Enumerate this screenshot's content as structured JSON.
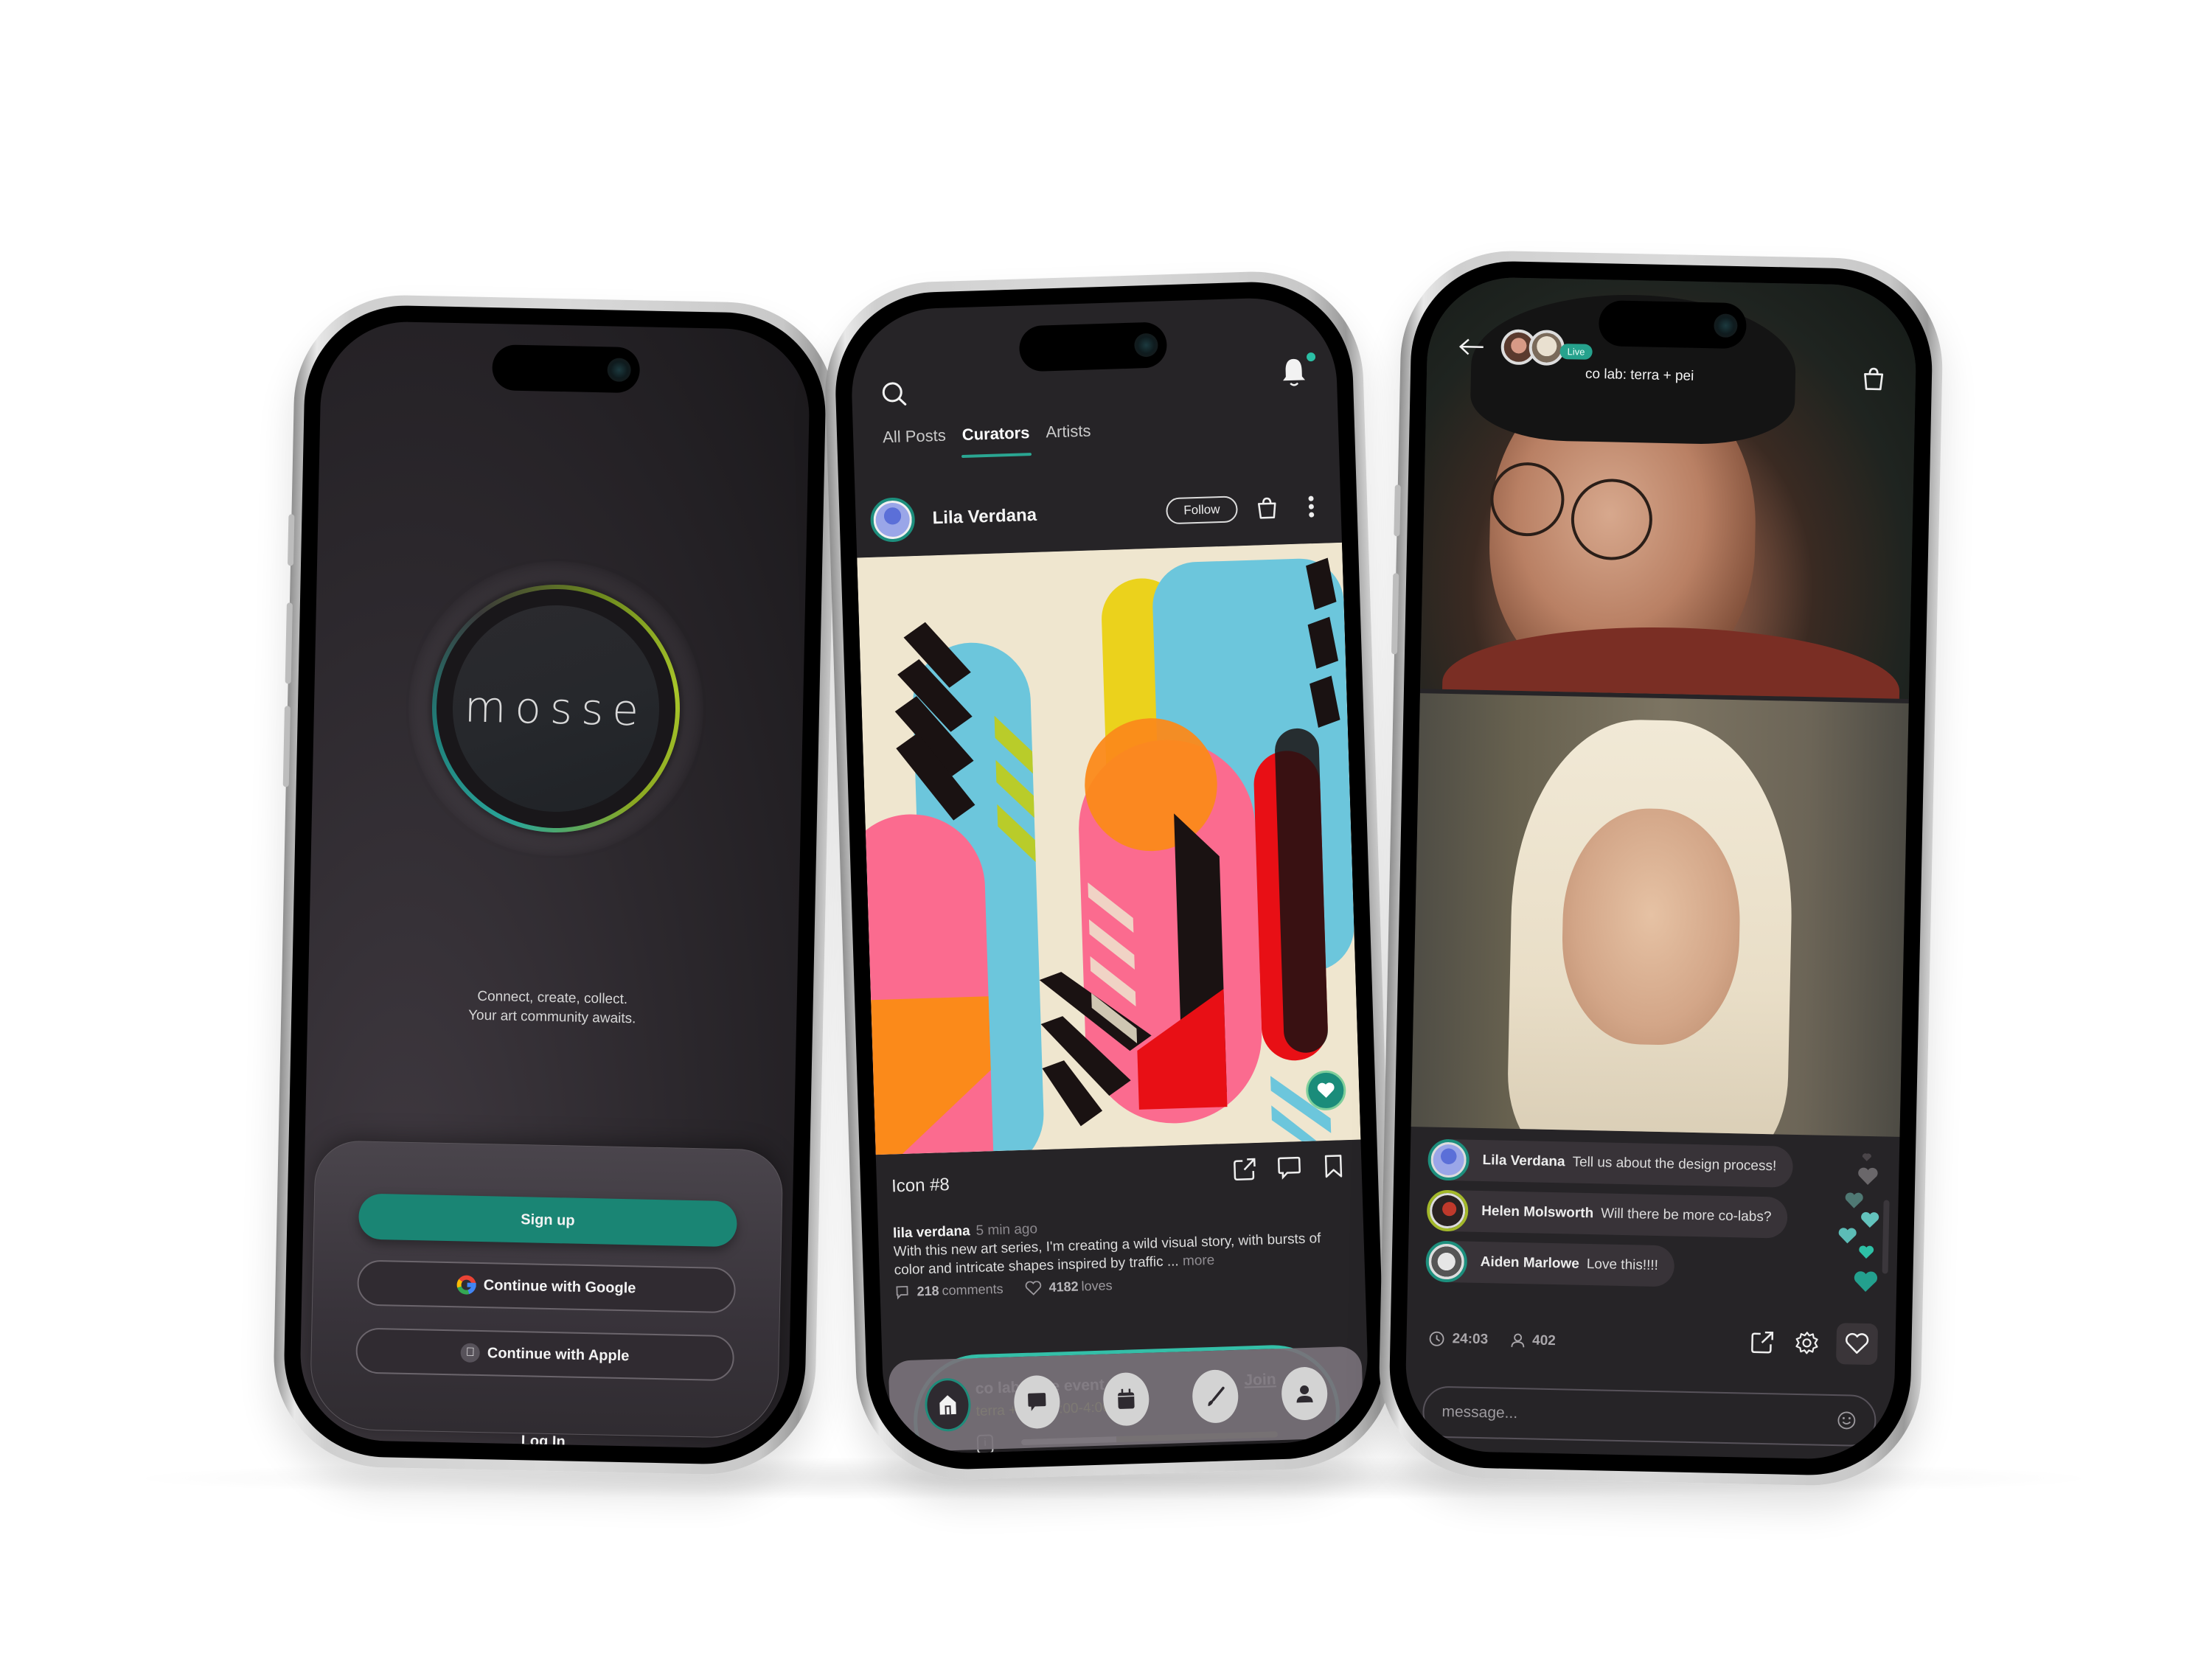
{
  "colors": {
    "accent_teal": "#1a8574",
    "accent_lime": "#b6cf2e",
    "bg_dark": "#262427",
    "live_badge": "#26a28d"
  },
  "onboarding": {
    "logo": "mosse",
    "tagline_line1": "Connect, create, collect.",
    "tagline_line2": "Your art community awaits.",
    "signup_label": "Sign up",
    "google_label": "Continue with Google",
    "apple_label": "Continue with Apple",
    "login_label": "Log In",
    "icons": {
      "google": "google-icon",
      "apple": "apple-icon"
    }
  },
  "feed": {
    "tabs": [
      {
        "label": "All Posts",
        "active": false
      },
      {
        "label": "Curators",
        "active": true
      },
      {
        "label": "Artists",
        "active": false
      }
    ],
    "has_notification": true,
    "post": {
      "author": "Lila Verdana",
      "follow_label": "Follow",
      "title": "Icon #8",
      "handle": "lila verdana",
      "time_ago": "5 min ago",
      "caption": "With this new art series, I'm creating a wild visual story, with bursts of color and intricate shapes inspired by traffic ...",
      "more_label": "more",
      "comments_count": "218",
      "comments_label": "comments",
      "loves_count": "4182",
      "loves_label": "loves"
    },
    "event": {
      "title": "co lab : live event",
      "subtitle": "terra + pei  /  3:00-4:00 pm",
      "join_label": "Join",
      "progress": 0.37
    },
    "nav": [
      {
        "name": "home",
        "icon": "home-icon",
        "active": true
      },
      {
        "name": "messages",
        "icon": "chat-bubble-icon",
        "active": false
      },
      {
        "name": "calendar",
        "icon": "calendar-icon",
        "active": false
      },
      {
        "name": "create",
        "icon": "paintbrush-icon",
        "active": false
      },
      {
        "name": "profile",
        "icon": "person-icon",
        "active": false
      }
    ]
  },
  "live": {
    "badge": "Live",
    "title": "co lab: terra + pei",
    "chat": [
      {
        "name": "Lila Verdana",
        "message": "Tell us about the design process!"
      },
      {
        "name": "Helen Molsworth",
        "message": "Will there be more co-labs?"
      },
      {
        "name": "Aiden Marlowe",
        "message": "Love this!!!!"
      }
    ],
    "duration": "24:03",
    "viewers": "402",
    "message_placeholder": "message..."
  }
}
